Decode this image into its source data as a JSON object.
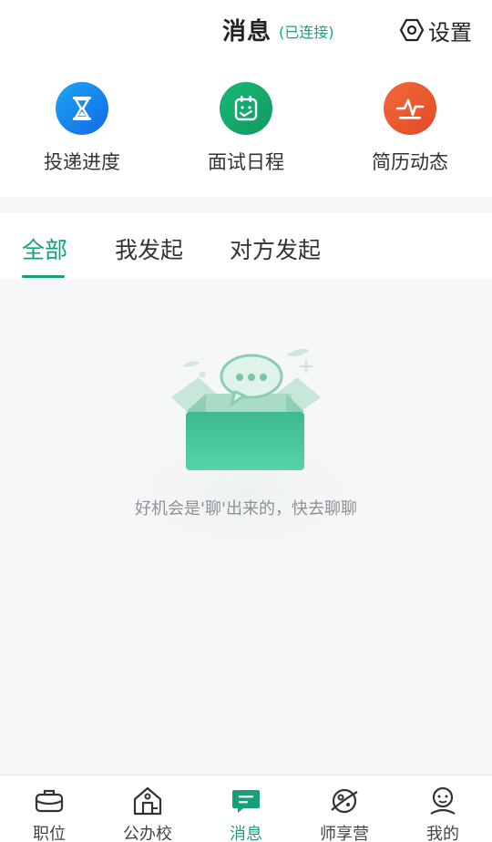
{
  "header": {
    "title": "消息",
    "connection_status": "(已连接)",
    "settings_label": "设置"
  },
  "quick_actions": [
    {
      "label": "投递进度",
      "icon": "hourglass-icon",
      "color": "#1f8bf0"
    },
    {
      "label": "面试日程",
      "icon": "calendar-icon",
      "color": "#13a86b"
    },
    {
      "label": "简历动态",
      "icon": "activity-icon",
      "color": "#ee5a32"
    }
  ],
  "tabs": [
    {
      "label": "全部",
      "active": true
    },
    {
      "label": "我发起",
      "active": false
    },
    {
      "label": "对方发起",
      "active": false
    }
  ],
  "empty_state": {
    "illustration": "chat-box-illustration",
    "text": "好机会是'聊'出来的，快去聊聊"
  },
  "bottom_nav": [
    {
      "label": "职位",
      "icon": "briefcase-icon",
      "active": false
    },
    {
      "label": "公办校",
      "icon": "school-icon",
      "active": false
    },
    {
      "label": "消息",
      "icon": "message-icon",
      "active": true
    },
    {
      "label": "师享营",
      "icon": "planet-icon",
      "active": false
    },
    {
      "label": "我的",
      "icon": "profile-icon",
      "active": false
    }
  ],
  "colors": {
    "accent": "#15a07a",
    "background": "#f6f7f8"
  }
}
